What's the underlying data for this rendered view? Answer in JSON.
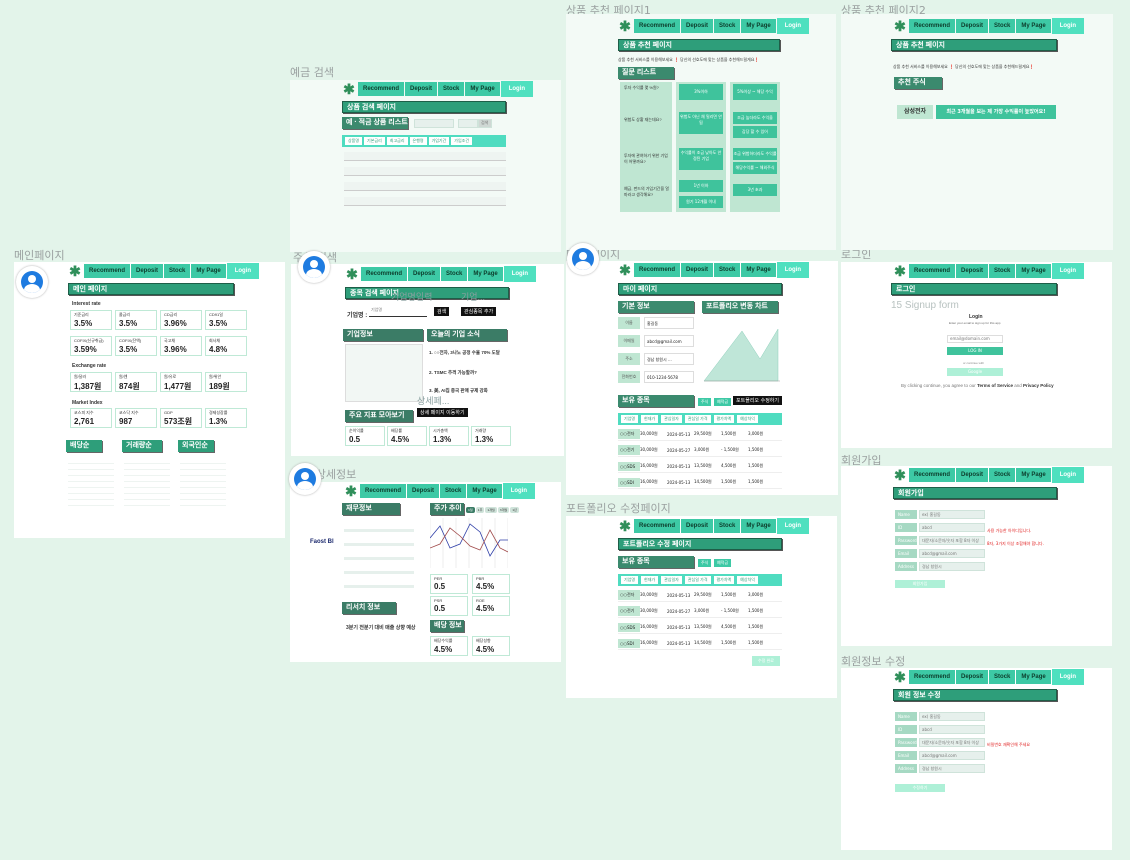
{
  "nav": {
    "recommend": "Recommend",
    "deposit": "Deposit",
    "stock": "Stock",
    "mypage": "My Page",
    "login": "Login"
  },
  "frames": {
    "main": "메인페이지",
    "deposit_search": "예금 검색",
    "rec1": "상품 추천 페이지1",
    "rec2": "상품 추천 페이지2",
    "stock_search": "주식 검색",
    "mypage": "마이 페이지",
    "login": "로그인",
    "stock_detail": "주식 상세정보",
    "portfolio": "포트폴리오 수정페이지",
    "signup": "회원가입",
    "edit": "회원정보 수정"
  },
  "main": {
    "title": "메인 페이지",
    "interest": "Interest rate",
    "exchange": "Exchange rate",
    "market": "Market Index",
    "rates": [
      {
        "l": "기준금리",
        "v": "3.5%"
      },
      {
        "l": "콜금리",
        "v": "3.5%"
      },
      {
        "l": "CD금리",
        "v": "3.96%"
      },
      {
        "l": "CD91일",
        "v": "3.5%"
      },
      {
        "l": "COFIX(신규취급)",
        "v": "3.59%"
      },
      {
        "l": "COFIX(잔액)",
        "v": "3.5%"
      },
      {
        "l": "국고채",
        "v": "3.96%"
      },
      {
        "l": "회사채",
        "v": "4.8%"
      }
    ],
    "fx": [
      {
        "l": "원/달러",
        "v": "1,387원"
      },
      {
        "l": "원/엔",
        "v": "874원"
      },
      {
        "l": "원/유로",
        "v": "1,477원"
      },
      {
        "l": "원/위안",
        "v": "189원"
      }
    ],
    "idx": [
      {
        "l": "코스피 지수",
        "v": "2,761"
      },
      {
        "l": "코스닥 지수",
        "v": "987"
      },
      {
        "l": "GDP",
        "v": "573조원"
      },
      {
        "l": "경제성장률",
        "v": "1.3%"
      }
    ],
    "tabs": [
      "배당순",
      "거래량순",
      "외국인순"
    ]
  },
  "deposit": {
    "title": "상품 검색 페이지",
    "list": "예 · 적금 상품 리스트",
    "search": "검색",
    "cols": [
      "상품명",
      "기본금리",
      "최고금리",
      "은행명",
      "가입기간",
      "가입조건"
    ]
  },
  "rec1": {
    "title": "상품 추천 페이지",
    "desc": "상품 추천 서비스를 이용해보세요 ❗ 당신의 선호도에 맞는 상품을 추천해드릴게요❗",
    "q": "질문 리스트",
    "qs": [
      "투자 수익률 몇 %원?",
      "위험도 상황 재는데요?",
      "투자에 관여하기 위한 기업이 어떻까요?",
      "예금, 펀드의 가입기간을 얼마라고 생각해요?"
    ],
    "a1": [
      "3%이하",
      "위험도 아닌 채 밀리면 안 됨",
      "수익률이 조금 낮아도 안정된 기업",
      "1년 이하",
      "원기 12개월 이내"
    ],
    "a2": [
      "5%이상 ~ 해당 수익",
      "조금 높더라도 수익을",
      "감당 할 수 있어",
      "조금 위험하더라도 수익률",
      "해당수익률 ~ 해외주식",
      "3년 초과"
    ]
  },
  "rec2": {
    "title": "상품 추천 페이지",
    "desc": "상품 추천 서비스를 이용해보세요 ❗ 당신의 선호도에 맞는 상품을 추천해드릴게요❗",
    "sec": "추천 주식",
    "stock": "삼성전자",
    "msg": "최근 3개월을 보는 제 가장 수익률이 높았어요!"
  },
  "stock": {
    "title": "종목 검색 페이지",
    "label": "기업명 :",
    "placeholder": "기업명",
    "search": "검색",
    "fav": "관심종목 추가",
    "info": "기업정보",
    "news": "오늘의 기업 소식",
    "n1": "1. ○○전자, 3나노 공정 수율 70% 도달",
    "n2": "2. TSMC 추격 가능할까?",
    "n3": "3. 美, AI칩 중국 판매 규제 강화",
    "detail": "상세 페이지 이동하기",
    "kpi": "주요 지표 모아보기",
    "k": [
      {
        "l": "순이익률",
        "v": "0.5"
      },
      {
        "l": "배당률",
        "v": "4.5%"
      },
      {
        "l": "시가총액",
        "v": "1.3%"
      },
      {
        "l": "거래량",
        "v": "1.3%"
      }
    ],
    "ghost1": "기업명입력",
    "ghost2": "기업...",
    "ghost3": "상세페..."
  },
  "detail": {
    "fin": "재무정보",
    "chart": "주가 추이",
    "ranges": [
      "1일",
      "1주",
      "1개월",
      "3개월",
      "1년"
    ],
    "report": "리서치 정보",
    "report_text": "3분기 전분기 대비 매출 상향 예상",
    "div": "배당 정보",
    "m": [
      {
        "l": "PER",
        "v": "0.5"
      },
      {
        "l": "PBR",
        "v": "4.5%"
      },
      {
        "l": "PSR",
        "v": "0.5"
      },
      {
        "l": "ROE",
        "v": "4.5%"
      }
    ],
    "dv": [
      {
        "l": "배당수익률",
        "v": "4.5%"
      },
      {
        "l": "배당성향",
        "v": "4.5%"
      }
    ],
    "side": "Faost Bl"
  },
  "mypage": {
    "title": "마이 페이지",
    "basic": "기본 정보",
    "chart": "포트폴리오 변동 차트",
    "holdings": "보유 종목",
    "fields": [
      [
        "이름",
        "홍길동"
      ],
      [
        "이메일",
        "abcd@gmail.com"
      ],
      [
        "주소",
        "경남 창원시 ..."
      ],
      [
        "전화번호",
        "010-1234-5678"
      ]
    ],
    "edit": "포트폴리오 수정하기",
    "chips": [
      "주식",
      "예적금"
    ]
  },
  "holdings": {
    "cols": [
      "기업명",
      "현재가",
      "관심일자",
      "관심일 가격",
      "평가차액",
      "예상차익"
    ],
    "rows": [
      [
        "○○전자",
        "30,000원",
        "2024-05-13",
        "29,500원",
        "1,500원",
        "3,000원"
      ],
      [
        "○○전기",
        "30,000원",
        "2024-05-27",
        "3,000원",
        "- 1,500원",
        "1,500원"
      ],
      [
        "○○SDS",
        "16,000원",
        "2024-05-13",
        "13,500원",
        "4,500원",
        "1,500원"
      ],
      [
        "○○SDI",
        "16,000원",
        "2024-05-13",
        "14,500원",
        "1,500원",
        "1,500원"
      ]
    ]
  },
  "portfolio": {
    "title": "포트폴리오 수정 페이지",
    "holdings": "보유 종목",
    "save": "수정 완료"
  },
  "login": {
    "title": "로그인",
    "signup": "15 Signup form",
    "h": "Login",
    "sub": "Enter your email to sign up for this app",
    "email": "email@domain.com",
    "btn": "LOG IN",
    "or": "or continue with",
    "google": "Google",
    "terms1": "By clicking continue, you agree to our",
    "tos": "Terms of Service",
    "and": "and",
    "pp": "Privacy Policy"
  },
  "signup": {
    "title": "회원가입",
    "fields": [
      "Name",
      "ID",
      "Password",
      "Email",
      "Address"
    ],
    "vals": [
      "ex) 홍길동",
      "abcd",
      "대문자/소문자/숫자 포함 8자 이상",
      "abcd@gmail.com",
      "경남 창원시"
    ],
    "err1": "사용 가능한 아이디입니다.",
    "err2": "8자, 3가지 이상 조합해야 합니다.",
    "btn": "회원가입"
  },
  "edit": {
    "title": "회원 정보 수정",
    "err": "비밀번호 재확인해 주세요",
    "btn": "수정하기"
  }
}
